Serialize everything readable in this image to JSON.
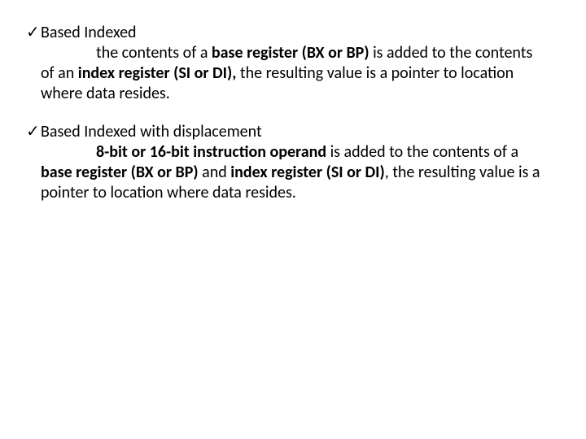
{
  "items": [
    {
      "check": "✓",
      "title": "Based Indexed",
      "detail_pre": "the contents of a ",
      "b1": "base register (BX or BP)",
      "mid1": " is added to the contents of an ",
      "b2": "index register (SI or DI),",
      "tail": " the resulting value is a pointer to location where data resides."
    },
    {
      "check": "✓",
      "title": "Based Indexed with displacement",
      "detail_pre": "8-bit or 16-bit instruction operand",
      "mid1": " is added to the contents of a ",
      "b2": "base register (BX or BP)",
      "mid2": " and ",
      "b3": "index register (SI or DI)",
      "tail": ", the resulting value is a pointer to location where data resides."
    }
  ]
}
